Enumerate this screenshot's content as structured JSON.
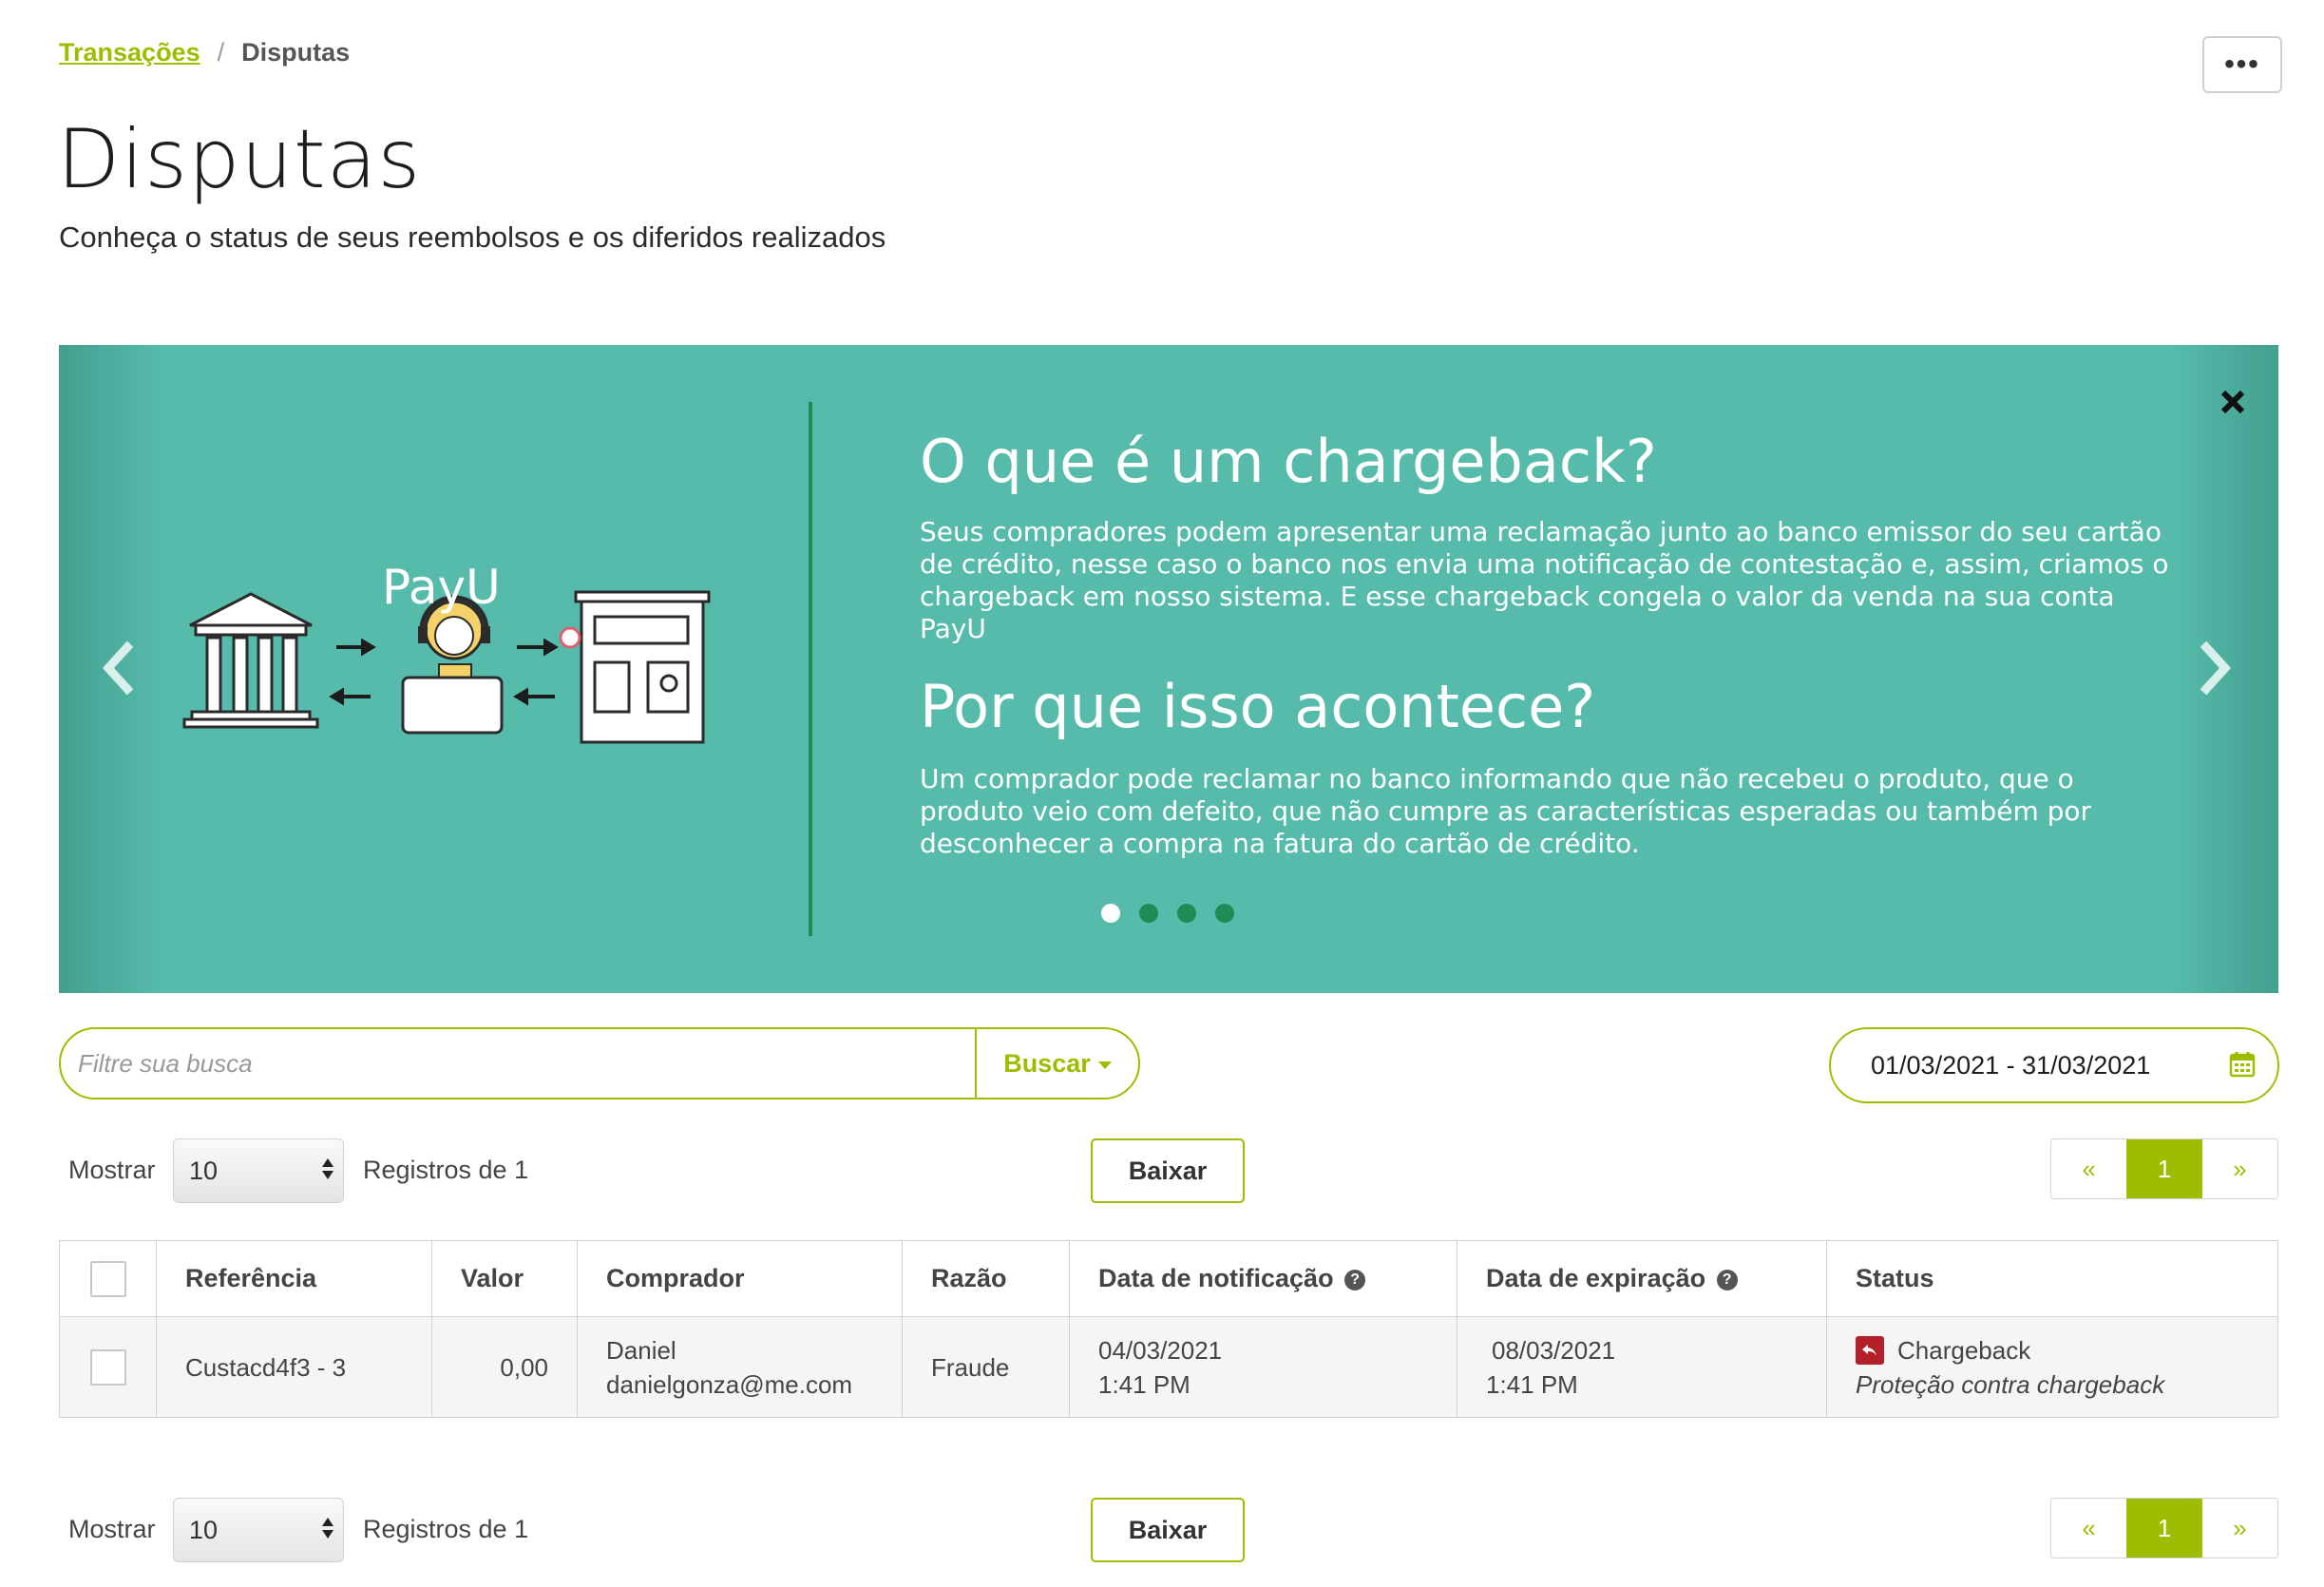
{
  "breadcrumb": {
    "parent": "Transações",
    "separator": "/",
    "current": "Disputas"
  },
  "header": {
    "more_label": "•••",
    "title": "Disputas",
    "subtitle": "Conheça o status de seus reembolsos e os diferidos realizados"
  },
  "banner": {
    "logo": "PayU",
    "heading1": "O que é um chargeback?",
    "text1": "Seus compradores podem apresentar uma reclamação junto ao banco emissor do seu cartão de crédito, nesse caso o banco nos envia uma notificação de contestação e, assim, criamos o chargeback em nosso sistema. E esse chargeback congela o valor da venda na sua conta PayU",
    "heading2": "Por que isso acontece?",
    "text2": "Um comprador pode reclamar no banco informando que não recebeu o produto, que o produto veio com defeito, que não cumpre as características esperadas ou também por desconhecer a compra na fatura do cartão de crédito.",
    "slides": 4,
    "active_slide": 1,
    "background_color": "#56bbab"
  },
  "filters": {
    "search_placeholder": "Filtre sua busca",
    "search_button": "Buscar",
    "date_range": "01/03/2021 - 31/03/2021"
  },
  "controls": {
    "show_label": "Mostrar",
    "page_size": "10",
    "records_label": "Registros de 1",
    "download_label": "Baixar",
    "pager": {
      "prev": "«",
      "current": "1",
      "next": "»"
    }
  },
  "table": {
    "headers": {
      "reference": "Referência",
      "value": "Valor",
      "buyer": "Comprador",
      "reason": "Razão",
      "notification_date": "Data de notificação",
      "expiration_date": "Data de expiração",
      "status": "Status"
    },
    "rows": [
      {
        "reference": "Custacd4f3 - 3",
        "value": "0,00",
        "buyer_name": "Daniel",
        "buyer_email": "danielgonza@me.com",
        "reason": "Fraude",
        "notification_date": "04/03/2021",
        "notification_time": "1:41 PM",
        "expiration_date": "08/03/2021",
        "expiration_time": "1:41 PM",
        "status": "Chargeback",
        "status_detail": "Proteção contra chargeback"
      }
    ]
  },
  "colors": {
    "accent": "#9fbc00",
    "chargeback_icon": "#b3202a",
    "banner_dark": "#1e8a5a"
  }
}
